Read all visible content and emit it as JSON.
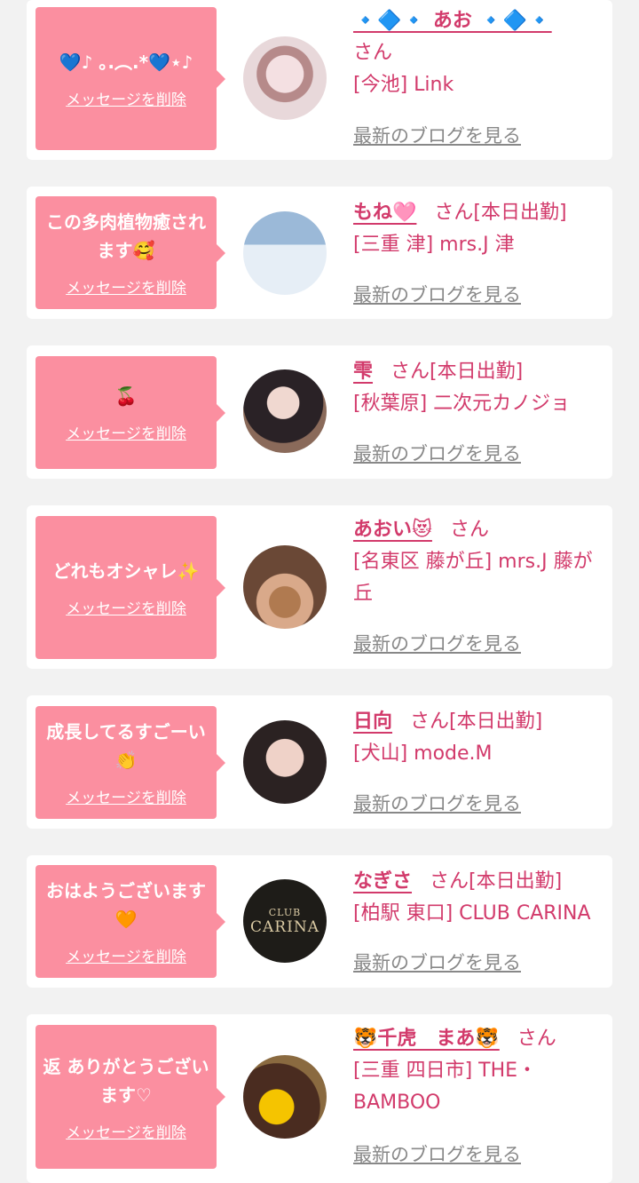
{
  "delete_label": "メッセージを削除",
  "blog_label": "最新のブログを見る",
  "san_label": "さん",
  "honorific_work": "さん[本日出勤]",
  "cards": [
    {
      "message": "💙♪ ｡.︵.*💙⋆♪",
      "name": "🔹🔷🔹 あお 🔹🔷🔹",
      "suffix": "さん",
      "shop": "[今池] Link"
    },
    {
      "message": "この多肉植物癒されます🥰",
      "name": "もね🩷",
      "suffix": "さん[本日出勤]",
      "shop": "[三重 津] mrs.J 津"
    },
    {
      "message": "🍒",
      "name": "雫",
      "suffix": "さん[本日出勤]",
      "shop": "[秋葉原] 二次元カノジョ"
    },
    {
      "message": "どれもオシャレ✨",
      "name": "あおい😻",
      "suffix": "さん",
      "shop": "[名東区 藤が丘] mrs.J 藤が丘"
    },
    {
      "message": "成長してるすごーい👏",
      "name": "日向",
      "suffix": "さん[本日出勤]",
      "shop": "[犬山] mode.M"
    },
    {
      "message": "おはようございます🧡",
      "name": "なぎさ",
      "suffix": "さん[本日出勤]",
      "shop": "[柏駅 東口] CLUB CARINA",
      "avatar_text": [
        "CLUB",
        "CARINA"
      ]
    },
    {
      "message": "返 ありがとうございます♡",
      "name": "🐯千虎　まあ🐯",
      "suffix": "さん",
      "shop": "[三重 四日市] THE・BAMBOO"
    }
  ],
  "colors": {
    "accent": "#d23a6b",
    "bubble": "#fb8fa0",
    "background": "#f2f2f2"
  }
}
